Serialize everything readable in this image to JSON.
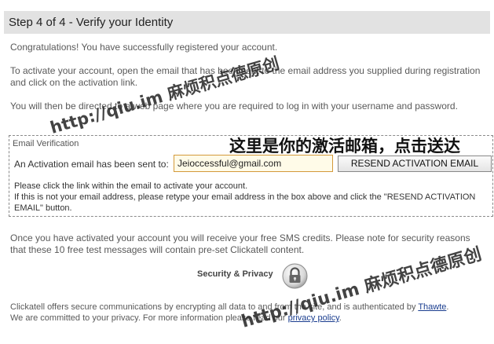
{
  "header": {
    "title": "Step 4 of 4 - Verify your Identity"
  },
  "intro": {
    "congrats": "Congratulations! You have successfully registered your account.",
    "activate": "To activate your account, open the email that has been sent to the email address you supplied during registration and click on the activation link.",
    "redirect": "You will then be directed to a web page where you are required to log in with your username and password."
  },
  "verification": {
    "legend": "Email Verification",
    "label": "An Activation email has been sent to:",
    "email_value": "Jeioccessful@gmail.com",
    "resend_label": "RESEND ACTIVATION EMAIL",
    "note": "Please click the link within the email to activate your account.",
    "note2": "If this is not your email address, please retype your email address in the box above and click the \"RESEND ACTIVATION EMAIL\" button."
  },
  "credits": {
    "text": "Once you have activated your account you will receive your free SMS credits. Please note for security reasons that these 10 free test messages will contain pre-set Clickatell content."
  },
  "security": {
    "label": "Security & Privacy",
    "icon": "lock-icon"
  },
  "footer": {
    "text1": "Clickatell offers secure communications by encrypting all data to and from the site, and is authenticated by ",
    "thawte": "Thawte",
    "text2": ".",
    "text3": "We are committed to your privacy. For more information please read our ",
    "privacy": "privacy policy",
    "text4": "."
  },
  "overlays": {
    "watermark": "http://qiu.im 麻烦积点德原创",
    "annotation": "这里是你的激活邮箱，点击送达"
  }
}
